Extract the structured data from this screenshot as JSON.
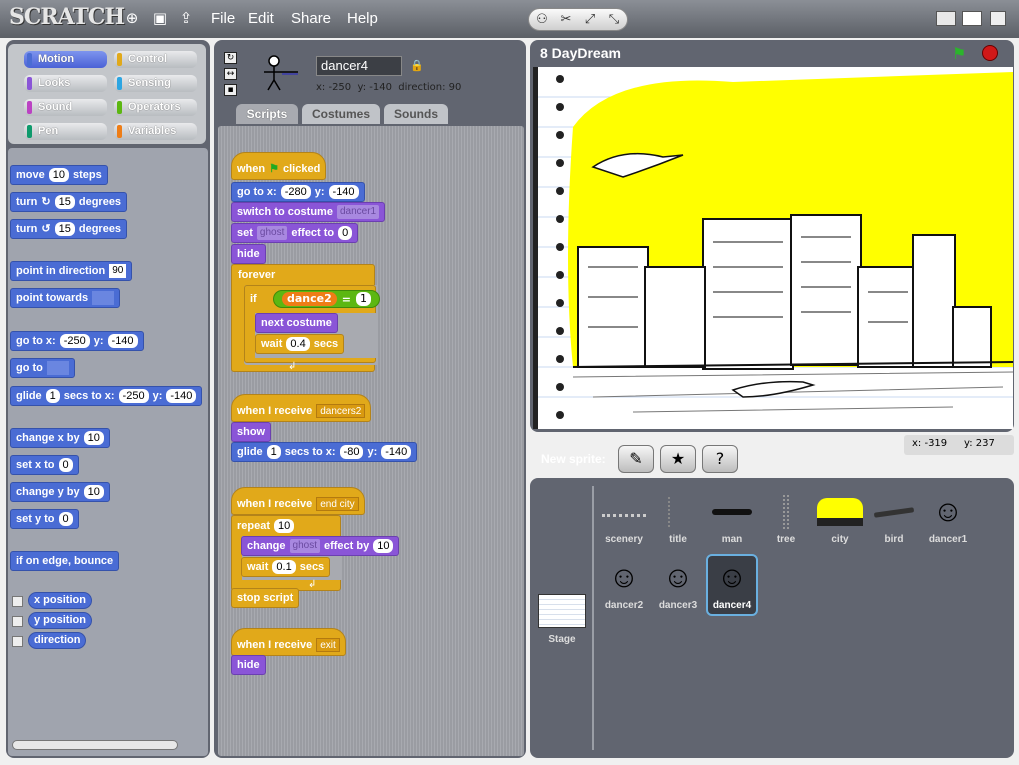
{
  "app": {
    "logo": "SCRATCH",
    "menus": [
      "File",
      "Edit",
      "Share",
      "Help"
    ]
  },
  "categories": [
    {
      "label": "Motion",
      "color": "#4a6cd4"
    },
    {
      "label": "Control",
      "color": "#e1a91a"
    },
    {
      "label": "Looks",
      "color": "#8a55d7"
    },
    {
      "label": "Sensing",
      "color": "#2ca5e2"
    },
    {
      "label": "Sound",
      "color": "#bb42c3"
    },
    {
      "label": "Operators",
      "color": "#5cb712"
    },
    {
      "label": "Pen",
      "color": "#0e9a6c"
    },
    {
      "label": "Variables",
      "color": "#ee7d16"
    }
  ],
  "palette": {
    "move": {
      "a": "move",
      "n": "10",
      "b": "steps"
    },
    "turn_cw": {
      "a": "turn",
      "n": "15",
      "b": "degrees"
    },
    "turn_ccw": {
      "a": "turn",
      "n": "15",
      "b": "degrees"
    },
    "point_dir": {
      "a": "point in direction",
      "n": "90"
    },
    "point_towards": {
      "a": "point towards"
    },
    "goto_xy": {
      "a": "go to x:",
      "x": "-250",
      "b": "y:",
      "y": "-140"
    },
    "goto": {
      "a": "go to"
    },
    "glide": {
      "a": "glide",
      "n": "1",
      "b": "secs to x:",
      "x": "-250",
      "c": "y:",
      "y": "-140"
    },
    "change_x": {
      "a": "change x by",
      "n": "10"
    },
    "set_x": {
      "a": "set x to",
      "n": "0"
    },
    "change_y": {
      "a": "change y by",
      "n": "10"
    },
    "set_y": {
      "a": "set y to",
      "n": "0"
    },
    "bounce": "if on edge, bounce",
    "x_position": "x position",
    "y_position": "y position",
    "direction": "direction"
  },
  "sprite": {
    "name": "dancer4",
    "info": "x: -250  y: -140  direction: 90",
    "tabs": [
      "Scripts",
      "Costumes",
      "Sounds"
    ]
  },
  "scripts": {
    "s1_hat": "when",
    "s1_hat2": "clicked",
    "s1_goto": {
      "a": "go to x:",
      "x": "-280",
      "b": "y:",
      "y": "-140"
    },
    "s1_switch": {
      "a": "switch to costume",
      "v": "dancer1"
    },
    "s1_set": {
      "a": "set",
      "v": "ghost",
      "b": "effect to",
      "n": "0"
    },
    "s1_hide": "hide",
    "s1_forever": "forever",
    "s1_if": "if",
    "s1_var": "dance2",
    "s1_eq": "=",
    "s1_eqv": "1",
    "s1_next": "next costume",
    "s1_wait": {
      "a": "wait",
      "n": "0.4",
      "b": "secs"
    },
    "s2_hat": {
      "a": "when I receive",
      "v": "dancers2"
    },
    "s2_show": "show",
    "s2_glide": {
      "a": "glide",
      "n": "1",
      "b": "secs to x:",
      "x": "-80",
      "c": "y:",
      "y": "-140"
    },
    "s3_hat": {
      "a": "when I receive",
      "v": "end city"
    },
    "s3_repeat": {
      "a": "repeat",
      "n": "10"
    },
    "s3_change": {
      "a": "change",
      "v": "ghost",
      "b": "effect by",
      "n": "10"
    },
    "s3_wait": {
      "a": "wait",
      "n": "0.1",
      "b": "secs"
    },
    "s3_stop": "stop script",
    "s4_hat": {
      "a": "when I receive",
      "v": "exit"
    },
    "s4_hide": "hide"
  },
  "stage": {
    "title": "8 DayDream",
    "coords_x": "x: -319",
    "coords_y": "y: 237"
  },
  "new_sprite_label": "New sprite:",
  "stage_label": "Stage",
  "sprites": [
    "scenery",
    "title",
    "man",
    "tree",
    "city",
    "bird",
    "dancer1",
    "dancer2",
    "dancer3",
    "dancer4"
  ],
  "selected_sprite": "dancer4",
  "colors": {
    "accent": "#4a6cd4",
    "stage_sky": "#ffff00"
  }
}
